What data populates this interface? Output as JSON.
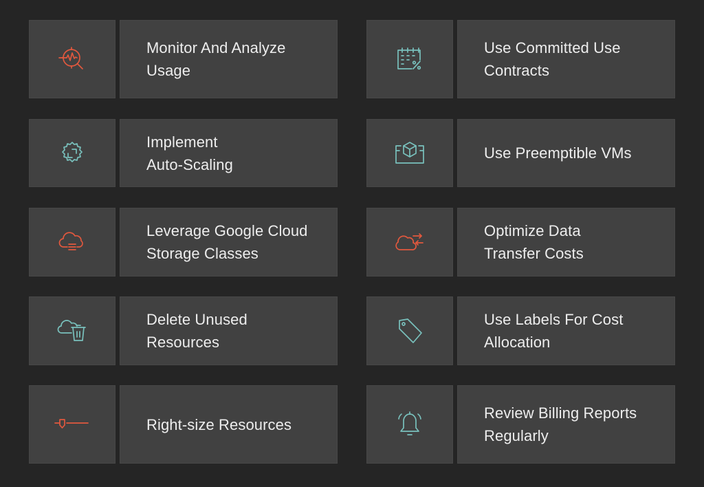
{
  "colors": {
    "background": "#252525",
    "tile": "#414141",
    "text": "#ededed",
    "accent_orange": "#e2583e",
    "accent_teal": "#79c1bd"
  },
  "items": [
    {
      "label": "Monitor And Analyze\nUsage",
      "icon": "monitor-analyze-icon",
      "icon_color": "orange"
    },
    {
      "label": "Use Committed Use\nContracts",
      "icon": "calendar-percent-icon",
      "icon_color": "teal"
    },
    {
      "label": "Implement\nAuto-Scaling",
      "icon": "gear-expand-icon",
      "icon_color": "teal"
    },
    {
      "label": "Use Preemptible VMs",
      "icon": "cube-box-icon",
      "icon_color": "teal"
    },
    {
      "label": "Leverage Google Cloud\nStorage Classes",
      "icon": "cloud-storage-icon",
      "icon_color": "orange"
    },
    {
      "label": "Optimize Data\nTransfer Costs",
      "icon": "cloud-transfer-icon",
      "icon_color": "orange"
    },
    {
      "label": "Delete Unused\nResources",
      "icon": "cloud-delete-icon",
      "icon_color": "teal"
    },
    {
      "label": "Use Labels For Cost\nAllocation",
      "icon": "tag-icon",
      "icon_color": "teal"
    },
    {
      "label": "Right-size Resources",
      "icon": "slider-icon",
      "icon_color": "orange"
    },
    {
      "label": "Review Billing Reports\nRegularly",
      "icon": "bell-icon",
      "icon_color": "teal"
    }
  ]
}
